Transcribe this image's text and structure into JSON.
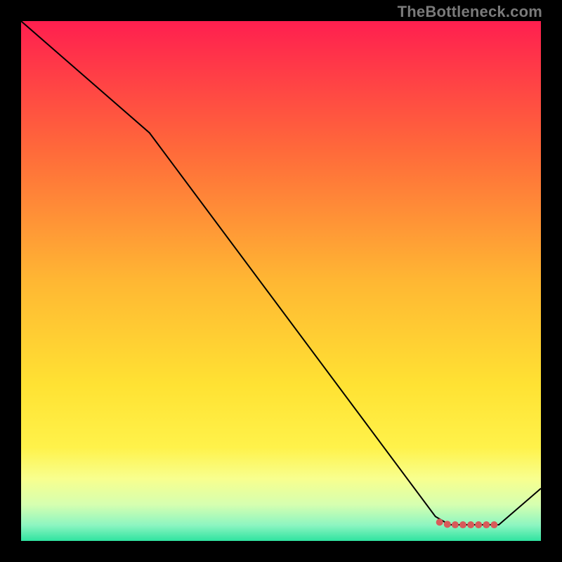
{
  "watermark": "TheBottleneck.com",
  "chart_data": {
    "type": "line",
    "title": "",
    "xlabel": "",
    "ylabel": "",
    "xlim": [
      0,
      100
    ],
    "ylim": [
      0,
      100
    ],
    "grid": false,
    "legend": {
      "visible": false
    },
    "background_gradient": {
      "stops": [
        {
          "pos": 0.0,
          "color": "#ff1f4f"
        },
        {
          "pos": 0.25,
          "color": "#ff6a3a"
        },
        {
          "pos": 0.5,
          "color": "#ffb733"
        },
        {
          "pos": 0.7,
          "color": "#ffe233"
        },
        {
          "pos": 0.82,
          "color": "#fff24a"
        },
        {
          "pos": 0.88,
          "color": "#f8ff8e"
        },
        {
          "pos": 0.93,
          "color": "#d6ffb0"
        },
        {
          "pos": 0.97,
          "color": "#8cf5c1"
        },
        {
          "pos": 1.0,
          "color": "#2fe3a0"
        }
      ]
    },
    "series": [
      {
        "name": "bottleneck-curve",
        "color": "#000000",
        "width": 2,
        "x": [
          0.0,
          24.7,
          79.7,
          82.4,
          91.9,
          100.0
        ],
        "y": [
          100.0,
          78.5,
          4.7,
          3.1,
          3.1,
          10.1
        ]
      }
    ],
    "markers": {
      "name": "used-in-test-points",
      "color": "#d85a5a",
      "radius": 5,
      "x": [
        80.5,
        82.0,
        83.5,
        85.0,
        86.5,
        88.0,
        89.5,
        91.0
      ],
      "y": [
        3.6,
        3.2,
        3.1,
        3.1,
        3.1,
        3.1,
        3.1,
        3.1
      ]
    }
  }
}
